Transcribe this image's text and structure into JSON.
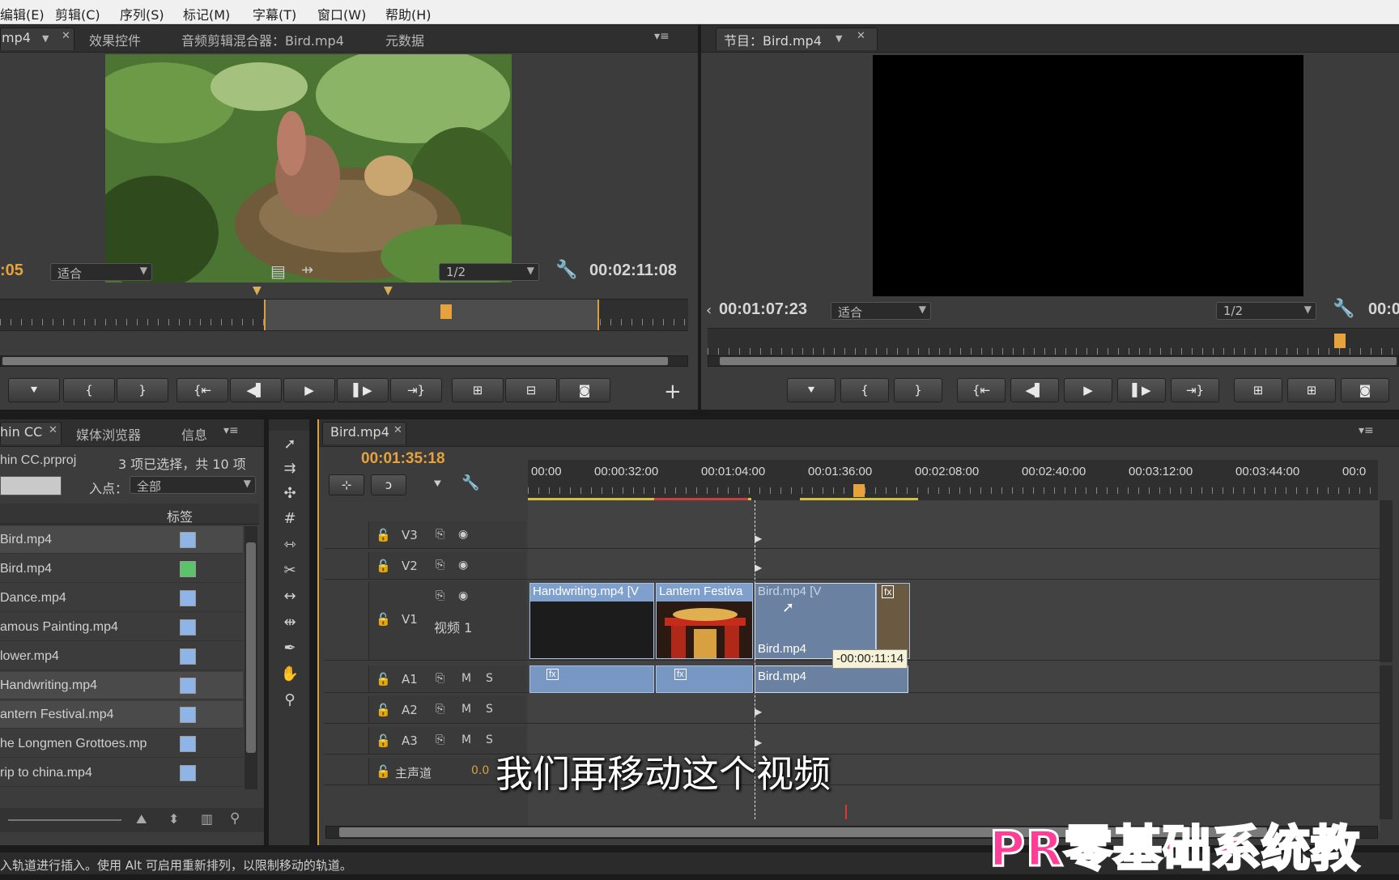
{
  "menu": [
    "编辑(E)",
    "剪辑(C)",
    "序列(S)",
    "标记(M)",
    "字幕(T)",
    "窗口(W)",
    "帮助(H)"
  ],
  "source_panel": {
    "tabs": [
      "mp4",
      "效果控件",
      "音频剪辑混合器：Bird.mp4",
      "元数据"
    ],
    "timecode_left": ":05",
    "fit_label": "适合",
    "resolution": "1/2",
    "duration": "00:02:11:08"
  },
  "program_panel": {
    "tab": "节目：Bird.mp4",
    "timecode": "00:01:07:23",
    "fit_label": "适合",
    "resolution": "1/2",
    "duration_partial": "00:0"
  },
  "project_panel": {
    "tabs": [
      "hin CC",
      "媒体浏览器",
      "信息"
    ],
    "file": "hin CC.prproj",
    "selection": "3 项已选择，共 10 项",
    "in_point_label": "入点：",
    "in_point_value": "全部",
    "label_header": "标签",
    "items": [
      {
        "name": "Bird.mp4",
        "color": "#8fb4e8"
      },
      {
        "name": "Bird.mp4",
        "color": "#5bc46a"
      },
      {
        "name": "Dance.mp4",
        "color": "#8fb4e8"
      },
      {
        "name": "amous Painting.mp4",
        "color": "#8fb4e8"
      },
      {
        "name": "lower.mp4",
        "color": "#8fb4e8"
      },
      {
        "name": "Handwriting.mp4",
        "color": "#8fb4e8"
      },
      {
        "name": "antern Festival.mp4",
        "color": "#8fb4e8"
      },
      {
        "name": "he Longmen Grottoes.mp",
        "color": "#8fb4e8"
      },
      {
        "name": "rip to china.mp4",
        "color": "#8fb4e8"
      }
    ]
  },
  "timeline": {
    "tab": "Bird.mp4",
    "timecode": "00:01:35:18",
    "ruler_labels": [
      "00:00",
      "00:00:32:00",
      "00:01:04:00",
      "00:01:36:00",
      "00:02:08:00",
      "00:02:40:00",
      "00:03:12:00",
      "00:03:44:00",
      "00:0"
    ],
    "tracks": {
      "v3": "V3",
      "v2": "V2",
      "v1": "V1",
      "v1_label": "视频 1",
      "a1": "A1",
      "a2": "A2",
      "a3": "A3",
      "master": "主声道",
      "master_value": "0.0",
      "m": "M",
      "s": "S"
    },
    "clips": {
      "handwriting": "Handwriting.mp4 [V",
      "lantern": "Lantern Festiva",
      "bird_ghost": "Bird.mp4 [V",
      "bird_drag": "Bird.mp4",
      "bird_audio": "Bird.mp4",
      "fx": "fx"
    },
    "offset_tooltip": "-00:00:11:14"
  },
  "status_bar": "入轨道进行插入。使用 Alt 可启用重新排列，以限制移动的轨道。",
  "subtitle": "我们再移动这个视频",
  "watermark": "PR零基础系统教"
}
